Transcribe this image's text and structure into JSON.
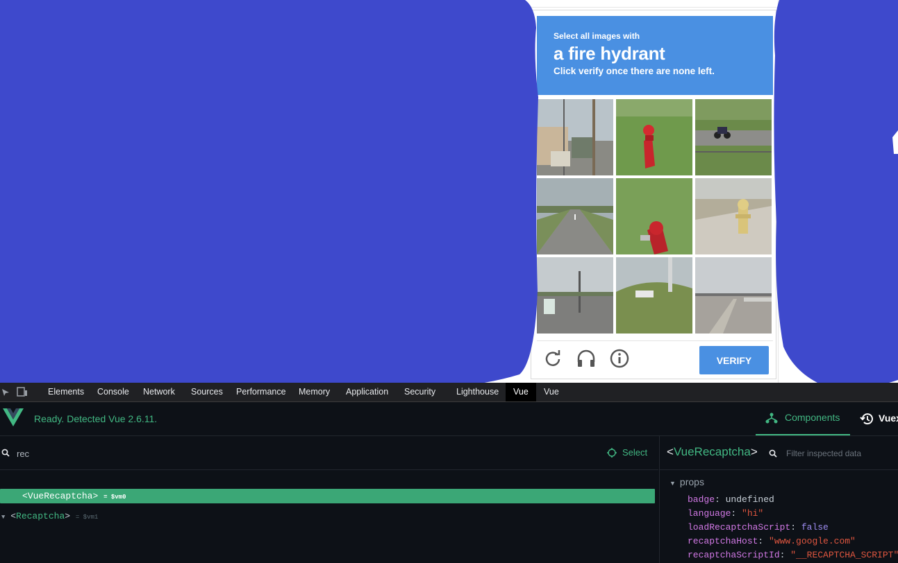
{
  "captcha": {
    "prompt_line1": "Select all images with",
    "prompt_object": "a fire hydrant",
    "prompt_line3": "Click verify once there are none left.",
    "tiles": [
      {
        "id": 1,
        "scene": "street-with-pole"
      },
      {
        "id": 2,
        "scene": "red-hydrant-grass"
      },
      {
        "id": 3,
        "scene": "motorcycle-road"
      },
      {
        "id": 4,
        "scene": "empty-road"
      },
      {
        "id": 5,
        "scene": "red-hydrant-grass-closeup"
      },
      {
        "id": 6,
        "scene": "yellow-hydrant-sidewalk"
      },
      {
        "id": 7,
        "scene": "street-with-bus"
      },
      {
        "id": 8,
        "scene": "grass-hill-car"
      },
      {
        "id": 9,
        "scene": "highway-divider"
      }
    ],
    "verify_label": "VERIFY",
    "icons": [
      "reload-icon",
      "headphones-icon",
      "info-icon"
    ]
  },
  "devtools": {
    "tabs": [
      "Elements",
      "Console",
      "Network",
      "Sources",
      "Performance",
      "Memory",
      "Application",
      "Security",
      "Lighthouse",
      "Vue",
      "Vue"
    ],
    "active_tab_index": 9,
    "vue": {
      "status": "Ready. Detected Vue 2.6.11.",
      "components_tab": "Components",
      "vuex_tab": "Vuex",
      "search_value": "rec",
      "select_label": "Select",
      "tree": [
        {
          "name": "Recaptcha",
          "ref": "= $vm1",
          "expanded": true,
          "selected": false
        },
        {
          "name": "VueRecaptcha",
          "ref": "= $vm0",
          "selected": true
        }
      ],
      "inspector": {
        "component": "VueRecaptcha",
        "filter_placeholder": "Filter inspected data",
        "section": "props",
        "props": [
          {
            "key": "badge",
            "value": "undefined",
            "kind": "undefined"
          },
          {
            "key": "language",
            "value": "\"hi\"",
            "kind": "string"
          },
          {
            "key": "loadRecaptchaScript",
            "value": "false",
            "kind": "boolean"
          },
          {
            "key": "recaptchaHost",
            "value": "\"www.google.com\"",
            "kind": "string"
          },
          {
            "key": "recaptchaScriptId",
            "value": "\"__RECAPTCHA_SCRIPT\"",
            "kind": "string"
          }
        ]
      }
    }
  },
  "colors": {
    "scribble": "#3e49cc",
    "captcha_blue": "#4a90e2",
    "vue_green": "#42b883",
    "selected_row": "#3ba776"
  }
}
